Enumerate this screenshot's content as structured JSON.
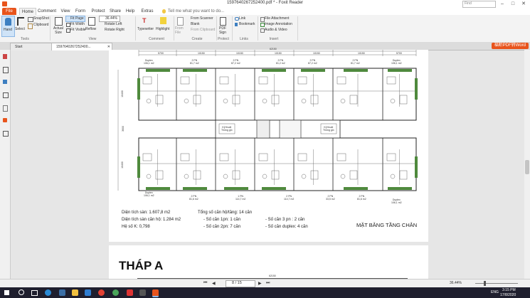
{
  "window": {
    "title": "1597640267252400.pdf * - Foxit Reader",
    "search_placeholder": "Find"
  },
  "menu": {
    "file": "File",
    "tabs": [
      "Home",
      "Comment",
      "View",
      "Form",
      "Protect",
      "Share",
      "Help",
      "Extras"
    ],
    "tell_me": "Tell me what you want to do..."
  },
  "ribbon": {
    "hand": "Hand",
    "select": "Select",
    "snapshot": "SnapShot",
    "clipboard": "Clipboard",
    "actual_size": "Actual Size",
    "fit_page": "Fit Page",
    "fit_width": "Fit Width",
    "fit_visible": "Fit Visible",
    "reflow": "Reflow",
    "zoom": "36.44%",
    "rotate_left": "Rotate Left",
    "rotate_right": "Rotate Right",
    "typewriter": "Typewriter",
    "highlight": "Highlight",
    "from_file": "From File",
    "from_scanner": "From Scanner",
    "blank": "Blank",
    "from_clipboard": "From Clipboard",
    "pdf_sign": "PDF Sign",
    "link": "Link",
    "bookmark": "Bookmark",
    "file_attachment": "File Attachment",
    "image_annotation": "Image Annotation",
    "audio_video": "Audio & Video",
    "groups": [
      "Tools",
      "View",
      "Comment",
      "Create",
      "Protect",
      "Links",
      "Insert"
    ]
  },
  "doc_tabs": {
    "start": "Start",
    "file": "1597640267252400...",
    "convert": "福昕PDF转Word"
  },
  "drawing": {
    "dims_top": [
      "5700",
      "10150",
      "10150",
      "10150",
      "10150",
      "10150",
      "5700"
    ],
    "total_top": "62150",
    "dims_left": [
      "10400",
      "3600",
      "10400"
    ],
    "apt_top": [
      "Duplex\n106,1 m2",
      "2 PN\n81,7 m2",
      "2 PN\n87,2 m2",
      "2 PN\n81,2 m2",
      "2 PN\n87,2 m2",
      "2 PN\n81,7 m2",
      "Duplex\n106,1 m2"
    ],
    "apt_bottom": [
      "Duplex\n106,1 m2",
      "2 PN\n81,6 m2",
      "1 PN\n114,7 m2",
      "2 PN\n114,7 m2",
      "2 PN\n33,5 m2",
      "2 PN\n81,6 m2",
      "Duplex\n106,1 m2"
    ],
    "shaft_label": "Kỹ thuật\nThông gió"
  },
  "summary": {
    "dien_tich_san": "Diện tích sàn: 1.607,8 m2",
    "dien_tich_can_ho": "Diện tích sàn căn hộ: 1.284 m2",
    "he_so": "Hệ số K: 0,798",
    "tong_so": "Tổng số căn hộ/tầng: 14 căn",
    "can_1pn": "- Số căn 1pn: 1 căn",
    "can_2pn": "- Số căn 2pn: 7 căn",
    "can_3pn": "- Số căn 3 pn   : 2 căn",
    "can_duplex": "- Số căn duplex: 4 căn",
    "plan_title": "MẶT BẰNG TẦNG CHẴN"
  },
  "page2": {
    "title": "THÁP A",
    "dim": "62150"
  },
  "status": {
    "page": "8 / 15",
    "zoom": "36.44%"
  },
  "taskbar": {
    "time": "3:15 PM",
    "date": "17/8/2020",
    "lang": "ENG"
  }
}
